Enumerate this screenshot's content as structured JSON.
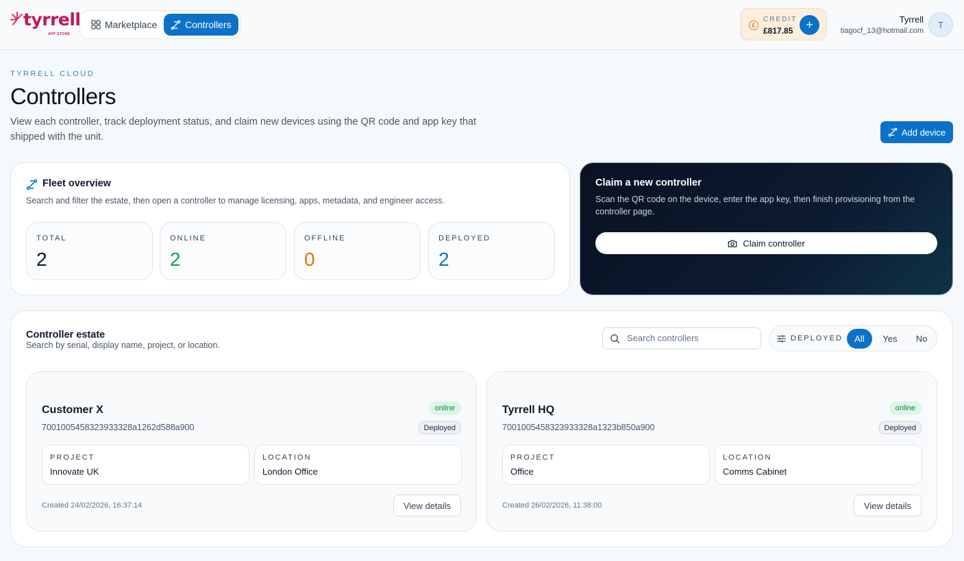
{
  "brand": {
    "name": "tyrrell",
    "sub": "APP STORE"
  },
  "nav": {
    "marketplace": "Marketplace",
    "controllers": "Controllers"
  },
  "credit": {
    "label": "CREDIT",
    "value": "£817.85",
    "symbol": "£"
  },
  "user": {
    "name": "Tyrrell",
    "email": "tiagocf_13@hotmail.com",
    "initial": "T"
  },
  "header": {
    "eyebrow": "TYRRELL CLOUD",
    "title": "Controllers",
    "description": "View each controller, track deployment status, and claim new devices using the QR code and app key that shipped with the unit.",
    "add_device": "Add device"
  },
  "fleet": {
    "title": "Fleet overview",
    "description": "Search and filter the estate, then open a controller to manage licensing, apps, metadata, and engineer access.",
    "stats": [
      {
        "label": "TOTAL",
        "value": "2",
        "color": "#0f172a"
      },
      {
        "label": "ONLINE",
        "value": "2",
        "color": "#16a34a"
      },
      {
        "label": "OFFLINE",
        "value": "0",
        "color": "#d97706"
      },
      {
        "label": "DEPLOYED",
        "value": "2",
        "color": "#0b72c8"
      }
    ]
  },
  "claim": {
    "title": "Claim a new controller",
    "description": "Scan the QR code on the device, enter the app key, then finish provisioning from the controller page.",
    "button": "Claim controller"
  },
  "estate": {
    "title": "Controller estate",
    "description": "Search by serial, display name, project, or location.",
    "search_placeholder": "Search controllers",
    "filter_label": "DEPLOYED",
    "filter_options": [
      "All",
      "Yes",
      "No"
    ],
    "filter_selected": "All",
    "project_label": "PROJECT",
    "location_label": "LOCATION",
    "view_details": "View details",
    "controllers": [
      {
        "name": "Customer X",
        "serial": "7001005458323933328a1262d588a900",
        "status": "online",
        "deployment": "Deployed",
        "project": "Innovate UK",
        "location": "London Office",
        "created": "Created 24/02/2026, 16:37:14"
      },
      {
        "name": "Tyrrell HQ",
        "serial": "7001005458323933328a1323b850a900",
        "status": "online",
        "deployment": "Deployed",
        "project": "Office",
        "location": "Comms Cabinet",
        "created": "Created 26/02/2026, 11:38:00"
      }
    ]
  }
}
